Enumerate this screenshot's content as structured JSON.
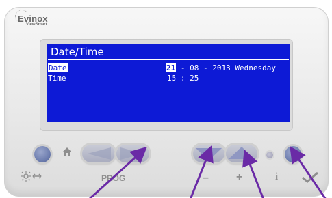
{
  "device": {
    "brand_name": "Evinox",
    "brand_sub": "ViewSmart"
  },
  "screen": {
    "title": "Date/Time",
    "rows": [
      {
        "label": "Date",
        "value_prefix": "",
        "day": "21",
        "value_rest": " - 08 - 2013  Wednesday"
      },
      {
        "label": "Time",
        "value": "15 : 25"
      }
    ]
  },
  "legends": {
    "prog": "PROG",
    "minus": "–",
    "plus": "+",
    "info": "i"
  },
  "colors": {
    "screen_bg": "#0d1ad6",
    "arrow": "#6a2aa6"
  },
  "icons": {
    "home": "home-icon",
    "sun_moon": "sun-moon-icon",
    "check": "check-icon"
  }
}
